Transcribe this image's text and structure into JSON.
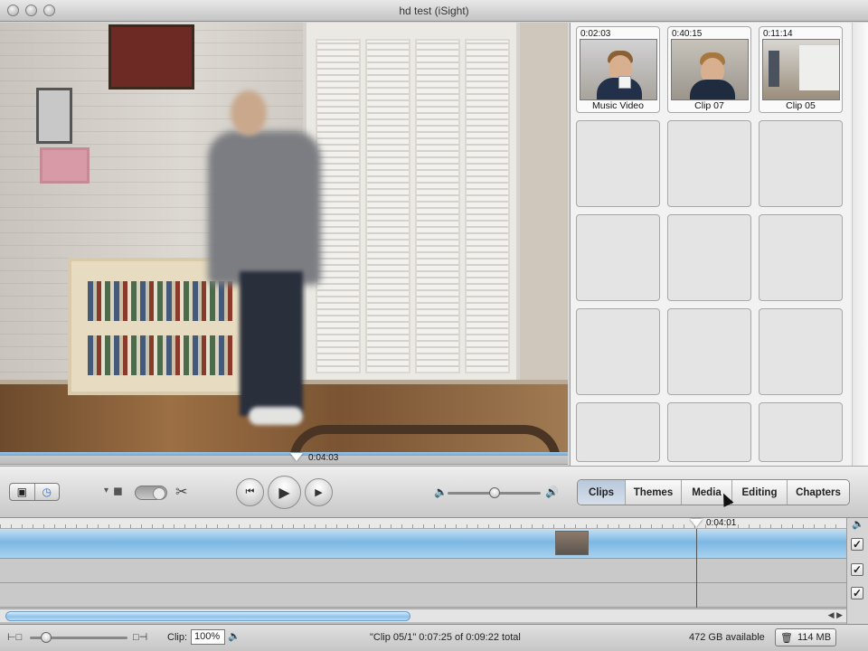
{
  "window": {
    "title": "hd test (iSight)"
  },
  "viewer": {
    "playhead_time": "0:04:03"
  },
  "clips": [
    {
      "duration": "0:02:03",
      "name": "Music Video"
    },
    {
      "duration": "0:40:15",
      "name": "Clip 07"
    },
    {
      "duration": "0:11:14",
      "name": "Clip 05"
    }
  ],
  "controls": {
    "tabs": [
      "Clips",
      "Themes",
      "Media",
      "Editing",
      "Chapters"
    ],
    "active_tab": "Clips",
    "volume_level": 0.5
  },
  "timeline": {
    "playhead_time": "0:04:01"
  },
  "status": {
    "zoom_label": "Clip:",
    "zoom_value": "100%",
    "clip_info": "\"Clip 05/1\"  0:07:25 of 0:09:22 total",
    "disk_available": "472 GB available",
    "trash_size": "114 MB"
  },
  "colors": {
    "accent_blue": "#7cb8e3",
    "tab_active": "#c6d4e5"
  }
}
